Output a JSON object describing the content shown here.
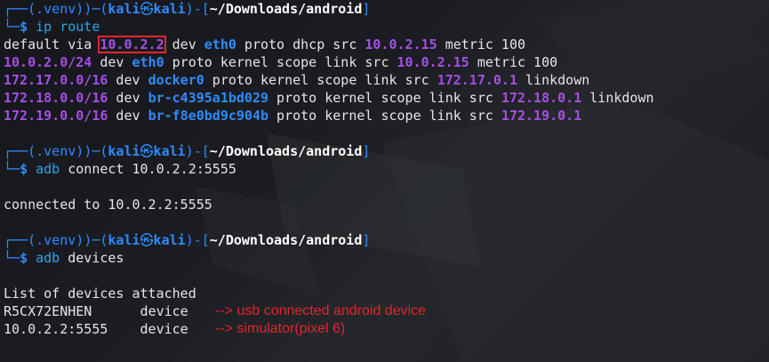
{
  "prompt": {
    "venv": "(.venv)",
    "user": "kali",
    "at": "㉿",
    "host": "kali",
    "path": "~/Downloads/android",
    "dollar": "$"
  },
  "commands": {
    "c1": "ip route",
    "c2": "adb connect 10.0.2.2:5555",
    "c3": "adb devices"
  },
  "route": {
    "l1": {
      "a": "default via ",
      "ip": "10.0.2.2",
      "b": " dev ",
      "dev": "eth0",
      "c": " proto dhcp src ",
      "src": "10.0.2.15",
      "d": " metric 100"
    },
    "l2": {
      "net": "10.0.2.0/24",
      "b": " dev ",
      "dev": "eth0",
      "c": " proto kernel scope link src ",
      "src": "10.0.2.15",
      "d": " metric 100"
    },
    "l3": {
      "net": "172.17.0.0/16",
      "b": " dev ",
      "dev": "docker0",
      "c": " proto kernel scope link src ",
      "src": "172.17.0.1",
      "d": " linkdown"
    },
    "l4": {
      "net": "172.18.0.0/16",
      "b": " dev ",
      "dev": "br-c4395a1bd029",
      "c": " proto kernel scope link src ",
      "src": "172.18.0.1",
      "d": " linkdown"
    },
    "l5": {
      "net": "172.19.0.0/16",
      "b": " dev ",
      "dev": "br-f8e0bd9c904b",
      "c": " proto kernel scope link src ",
      "src": "172.19.0.1",
      "d": ""
    }
  },
  "connect_output": "connected to 10.0.2.2:5555",
  "devices": {
    "header": "List of devices attached",
    "d1": {
      "id": "R5CX72ENHEN",
      "sep": "      ",
      "state": "device",
      "note": "--> usb connected android device"
    },
    "d2": {
      "id": "10.0.2.2:5555",
      "sep": "    ",
      "state": "device",
      "note": "--> simulator(pixel 6)"
    }
  },
  "colors": {
    "prompt_blue": "#2f8cff",
    "highlight_purple": "#a64fe6",
    "annotation_red": "#e0262a",
    "background": "#1b1d22"
  }
}
